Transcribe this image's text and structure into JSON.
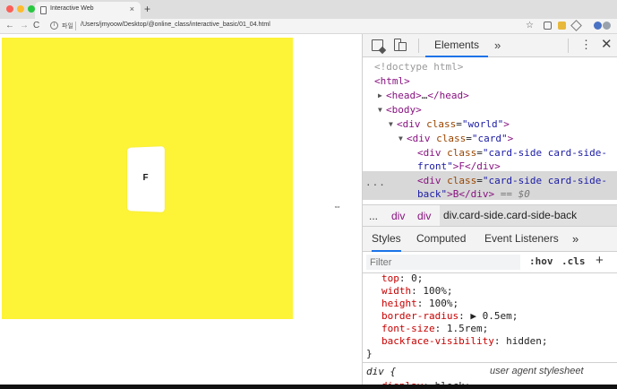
{
  "browser": {
    "tab_title": "Interactive Web",
    "tab_close": "×",
    "new_tab": "+",
    "nav_back": "←",
    "nav_forward": "→",
    "nav_reload": "C",
    "info_icon": "i",
    "url_scheme": "파일",
    "url": "/Users/jmyoow/Desktop/@online_class/interactive_basic/01_04.html",
    "bookmark_icon": "☆"
  },
  "page": {
    "card_text": "F",
    "world_color": "#fdf337",
    "resize_cursor": "⇔"
  },
  "devtools": {
    "active_tab": "Elements",
    "more_tabs": "»",
    "kebab": "⋮",
    "close": "✕",
    "dom": {
      "doctype": "<!doctype html>",
      "html_open": "<html>",
      "head_tag": "<head>",
      "head_ellipsis": "…",
      "head_close": "</head>",
      "body_tag": "<body>",
      "world_tag": "<div ",
      "world_attr": "class",
      "world_val": "\"world\"",
      "card_tag": "<div ",
      "card_attr": "class",
      "card_val": "\"card\"",
      "front_tag": "<div ",
      "front_attr": "class",
      "front_val_1": "\"card-side card-side-",
      "front_val_2": "front\"",
      "front_content": ">F</div>",
      "back_tag": "<div ",
      "back_attr": "class",
      "back_val_1": "\"card-side card-side-",
      "back_val_2": "back\"",
      "back_content": ">B</div>",
      "back_eq": " == $0",
      "row_dots": "..."
    },
    "breadcrumbs": [
      "...",
      "div",
      "div",
      "div.card-side.card-side-back"
    ],
    "styles_tabs": {
      "styles": "Styles",
      "computed": "Computed",
      "listeners": "Event Listeners",
      "more": "»"
    },
    "filter": {
      "placeholder": "Filter",
      "hov": ":hov",
      "cls": ".cls",
      "add": "+"
    },
    "css_rules": [
      {
        "prop": "top",
        "value": "0;"
      },
      {
        "prop": "width",
        "value": "100%;"
      },
      {
        "prop": "height",
        "value": "100%;"
      },
      {
        "prop": "border-radius",
        "value": "▶ 0.5em;"
      },
      {
        "prop": "font-size",
        "value": "1.5rem;"
      },
      {
        "prop": "backface-visibility",
        "value": "hidden;"
      }
    ],
    "close_brace": "}",
    "ua_selector": "div {",
    "ua_source": "user agent stylesheet",
    "ua_prop": "display",
    "ua_value": "block;"
  }
}
